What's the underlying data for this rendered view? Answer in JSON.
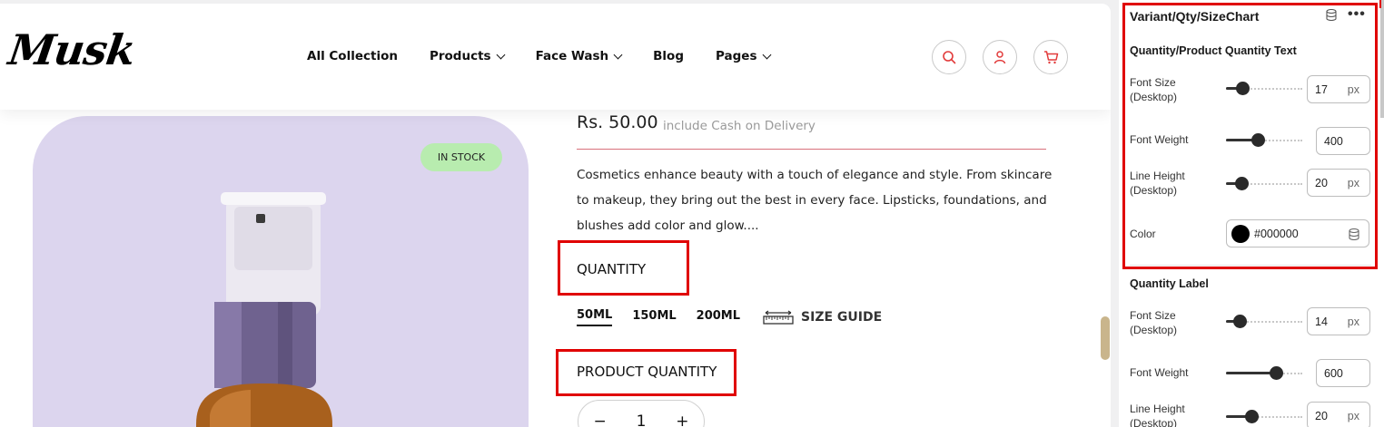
{
  "header": {
    "logo": "Musk",
    "nav": [
      {
        "label": "All Collection",
        "has_dropdown": false
      },
      {
        "label": "Products",
        "has_dropdown": true
      },
      {
        "label": "Face Wash",
        "has_dropdown": true
      },
      {
        "label": "Blog",
        "has_dropdown": false
      },
      {
        "label": "Pages",
        "has_dropdown": true
      }
    ],
    "icons": [
      "search-icon",
      "user-icon",
      "cart-icon"
    ],
    "icon_color": "#e23b3b"
  },
  "product": {
    "badge": "IN STOCK",
    "price": "Rs. 50.00",
    "price_note": "include Cash on Delivery",
    "description": "Cosmetics enhance beauty with a touch of elegance and style. From skincare to makeup, they bring out the best in every face. Lipsticks, foundations, and blushes add color and glow....",
    "quantity_label": "QUANTITY",
    "variants": [
      "50ML",
      "150ML",
      "200ML"
    ],
    "selected_variant": "50ML",
    "size_guide": "SIZE GUIDE",
    "product_quantity_label": "PRODUCT QUANTITY",
    "qty_value": "1",
    "qty_minus": "−",
    "qty_plus": "+",
    "image_bg": "#dcd5ee"
  },
  "panel": {
    "title": "Variant/Qty/SizeChart",
    "section1": {
      "title": "Quantity/Product Quantity Text",
      "font_size_label": "Font Size (Desktop)",
      "font_size": "17",
      "font_weight_label": "Font Weight",
      "font_weight": "400",
      "line_height_label": "Line Height (Desktop)",
      "line_height": "20",
      "color_label": "Color",
      "color": "#000000"
    },
    "section2": {
      "title": "Quantity Label",
      "font_size_label": "Font Size (Desktop)",
      "font_size": "14",
      "font_weight_label": "Font Weight",
      "font_weight": "600",
      "line_height_label": "Line Height (Desktop)",
      "line_height": "20"
    },
    "unit": "px",
    "slider_levels": {
      "s1_size": 0.22,
      "s1_weight": 0.42,
      "s1_line": 0.2,
      "s2_size": 0.18,
      "s2_weight": 0.66,
      "s2_line": 0.33
    }
  },
  "highlight_color": "#e00000"
}
